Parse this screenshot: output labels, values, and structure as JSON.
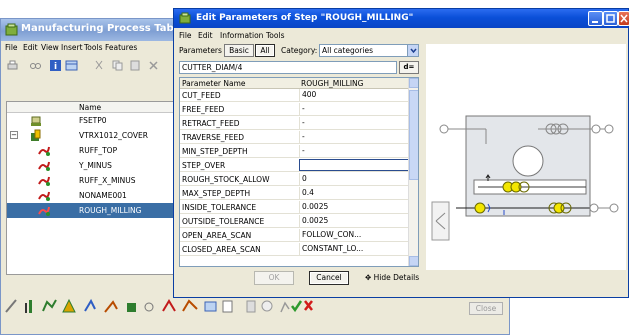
{
  "background_window": {
    "title": "Manufacturing Process Table",
    "menu": [
      "File",
      "Edit",
      "View",
      "Insert",
      "Tools",
      "Features"
    ],
    "tree_header": "Name",
    "tree_rows": [
      {
        "label": "FSETP0",
        "icon": "fixture-setup-icon",
        "selected": false
      },
      {
        "label": "VTRX1012_COVER",
        "icon": "workpiece-icon",
        "selected": false
      },
      {
        "label": "RUFF_TOP",
        "icon": "milling-step-icon",
        "selected": false
      },
      {
        "label": "Y_MINUS",
        "icon": "milling-step-icon",
        "selected": false
      },
      {
        "label": "RUFF_X_MINUS",
        "icon": "milling-step-icon",
        "selected": false
      },
      {
        "label": "NONAME001",
        "icon": "milling-step-icon",
        "selected": false
      },
      {
        "label": "ROUGH_MILLING",
        "icon": "milling-step-icon",
        "selected": true
      }
    ],
    "close_label": "Close"
  },
  "dialog": {
    "title": "Edit Parameters of Step \"ROUGH_MILLING\"",
    "menu": [
      "File",
      "Edit",
      "Information",
      "Tools"
    ],
    "parameters_label": "Parameters",
    "basic_label": "Basic",
    "all_label": "All",
    "category_label": "Category:",
    "category_value": "All categories",
    "formula_value": "CUTTER_DIAM/4",
    "deq_label": "d=",
    "grid_headers": [
      "Parameter Name",
      "ROUGH_MILLING"
    ],
    "rows": [
      {
        "name": "CUT_FEED",
        "value": "400"
      },
      {
        "name": "FREE_FEED",
        "value": "-"
      },
      {
        "name": "RETRACT_FEED",
        "value": "-"
      },
      {
        "name": "TRAVERSE_FEED",
        "value": "-"
      },
      {
        "name": "MIN_STEP_DEPTH",
        "value": "-"
      },
      {
        "name": "STEP_OVER",
        "value": ""
      },
      {
        "name": "ROUGH_STOCK_ALLOW",
        "value": "0"
      },
      {
        "name": "MAX_STEP_DEPTH",
        "value": "0.4"
      },
      {
        "name": "INSIDE_TOLERANCE",
        "value": "0.0025"
      },
      {
        "name": "OUTSIDE_TOLERANCE",
        "value": "0.0025"
      },
      {
        "name": "OPEN_AREA_SCAN",
        "value": "FOLLOW_CON..."
      },
      {
        "name": "CLOSED_AREA_SCAN",
        "value": "CONSTANT_LO..."
      }
    ],
    "ok_label": "OK",
    "cancel_label": "Cancel",
    "hide_details_label": "Hide Details"
  },
  "colors": {
    "selection": "#3a6ea5",
    "dialog_title": "#0a4fd8",
    "preview_highlight": "#f3e600"
  }
}
